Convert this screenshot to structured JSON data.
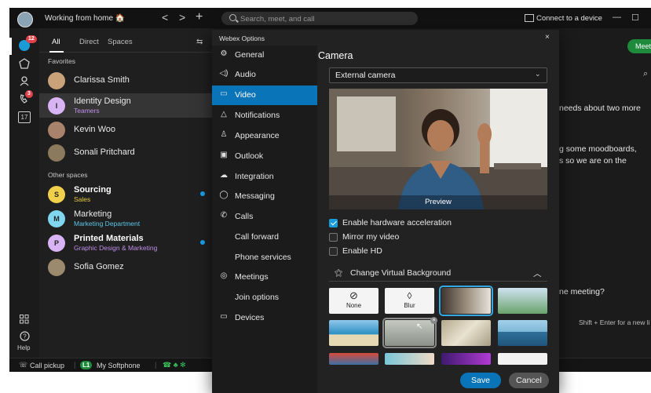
{
  "titlebar": {
    "status": "Working from home 🏠",
    "back": "<",
    "forward": ">",
    "new": "+",
    "search_placeholder": "Search, meet, and call",
    "connect_device": "Connect to a device",
    "minimize": "—",
    "maximize": "☐"
  },
  "rail": {
    "messages_badge": "12",
    "calls_badge": "3",
    "calendar_day": "17",
    "help": "Help"
  },
  "list": {
    "tabs": [
      "All",
      "Direct",
      "Spaces"
    ],
    "favorites_header": "Favorites",
    "other_header": "Other spaces",
    "favorites": [
      {
        "name": "Clarissa Smith",
        "sub": "",
        "initial": "",
        "color": "#c9a27a"
      },
      {
        "name": "Identity Design",
        "sub": "Teamers",
        "initial": "I",
        "color": "#d8b4f5"
      },
      {
        "name": "Kevin Woo",
        "sub": "",
        "initial": "",
        "color": "#a8826a"
      },
      {
        "name": "Sonali Pritchard",
        "sub": "",
        "initial": "",
        "color": "#8c7a5e"
      }
    ],
    "spaces": [
      {
        "name": "Sourcing",
        "sub": "Sales",
        "initial": "S",
        "color": "#f2d04b"
      },
      {
        "name": "Marketing",
        "sub": "Marketing Department",
        "initial": "M",
        "color": "#7fd6ee"
      },
      {
        "name": "Printed Materials",
        "sub": "Graphic Design & Marketing",
        "initial": "P",
        "color": "#d8b4f5"
      },
      {
        "name": "Sofia Gomez",
        "sub": "",
        "initial": "",
        "color": "#9b8a6e"
      }
    ]
  },
  "bottombar": {
    "call_pickup": "Call pickup",
    "line_badge": "L1",
    "softphone": "My Softphone"
  },
  "chat": {
    "meet": "Meet",
    "lines": [
      "needs about two more",
      "g some moodboards,",
      "s so we are on the",
      "ne meeting?",
      "Shift + Enter for a new li"
    ]
  },
  "dialog": {
    "title": "Webex Options",
    "close": "×",
    "nav": [
      {
        "label": "General",
        "icon": "⚙",
        "sub": false
      },
      {
        "label": "Audio",
        "icon": "◁)",
        "sub": false
      },
      {
        "label": "Video",
        "icon": "▭",
        "sub": false
      },
      {
        "label": "Notifications",
        "icon": "△",
        "sub": false
      },
      {
        "label": "Appearance",
        "icon": "♙",
        "sub": false
      },
      {
        "label": "Outlook",
        "icon": "▣",
        "sub": false
      },
      {
        "label": "Integration",
        "icon": "☁",
        "sub": false
      },
      {
        "label": "Messaging",
        "icon": "◯",
        "sub": false
      },
      {
        "label": "Calls",
        "icon": "✆",
        "sub": false
      },
      {
        "label": "Call forward",
        "icon": "",
        "sub": true
      },
      {
        "label": "Phone services",
        "icon": "",
        "sub": true
      },
      {
        "label": "Meetings",
        "icon": "◎",
        "sub": false
      },
      {
        "label": "Join options",
        "icon": "",
        "sub": true
      },
      {
        "label": "Devices",
        "icon": "▭",
        "sub": false
      }
    ],
    "section_title": "Camera",
    "camera_select": "External camera",
    "preview_label": "Preview",
    "checkboxes": [
      {
        "label": "Enable hardware acceleration",
        "checked": true
      },
      {
        "label": "Mirror my video",
        "checked": false
      },
      {
        "label": "Enable HD",
        "checked": false
      }
    ],
    "vbg_title": "Change Virtual Background",
    "vbg_none": "None",
    "vbg_blur": "Blur",
    "save": "Save",
    "cancel": "Cancel"
  }
}
